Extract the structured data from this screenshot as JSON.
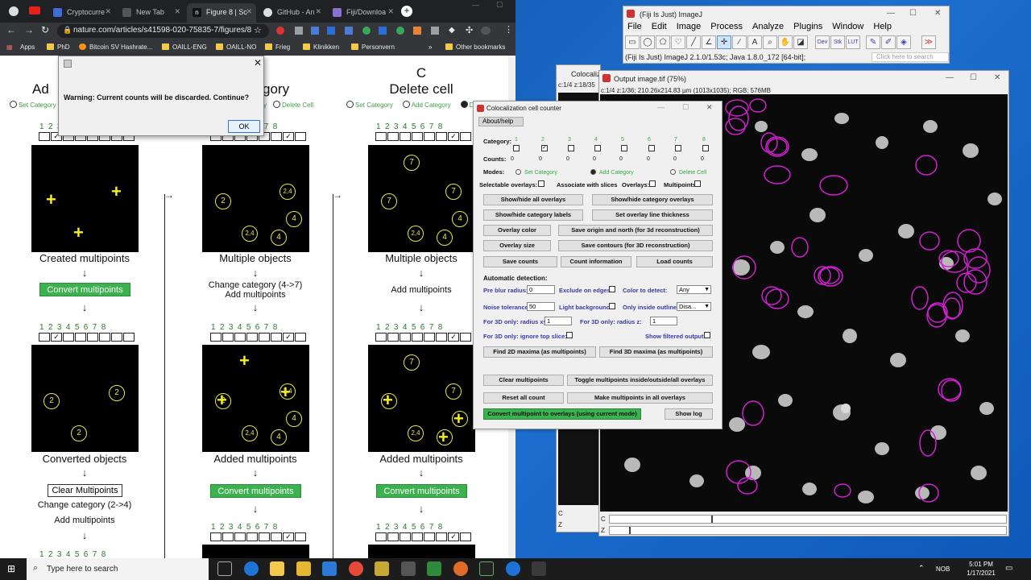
{
  "browser": {
    "tabs": [
      {
        "label": "Cryptocurre",
        "color": "#3b6fd6"
      },
      {
        "label": "New Tab",
        "color": "#555"
      },
      {
        "label": "Figure 8 | Sc",
        "color": "#e8eaed"
      },
      {
        "label": "GitHub - An",
        "color": "#ddd"
      },
      {
        "label": "Fiji/Downloa",
        "color": "#8b6fd1"
      }
    ],
    "url": "nature.com/articles/s41598-020-75835-7/figures/8",
    "bookmarks": [
      "Apps",
      "PhD",
      "Bitcoin SV Hashrate...",
      "OAILL-ENG",
      "OAILL-NO",
      "Frieg",
      "Klinikken",
      "Personvern"
    ],
    "other_bookmarks": "Other bookmarks"
  },
  "figure": {
    "col_a_title": "Ad",
    "col_b_title": "gory",
    "col_c_letter": "C",
    "col_c_title": "Delete cell",
    "radio_set": "Set Category",
    "radio_add": "Add Category",
    "radio_del": "Delete Cell",
    "radio_del_short": "Dele",
    "cat_numbers": "12345678",
    "a_lbl1": "Created multipoints",
    "a_btn1": "Convert multipoints",
    "a_lbl2": "Converted objects",
    "a_btn2": "Clear Multipoints",
    "a_txt1": "Change category (2->4)",
    "a_txt2": "Add multipoints",
    "b_lbl1": "Multiple objects",
    "b_txt1": "Change category (4->7)",
    "b_txt2": "Add multipoints",
    "b_lbl2": "Added multipoints",
    "b_btn": "Convert multipoints",
    "c_lbl1": "Multiple objects",
    "c_txt1": "Add multipoints",
    "c_lbl2": "Added multipoints",
    "c_btn": "Convert multipoints"
  },
  "dialog": {
    "message": "Warning: Current counts will be discarded. Continue?",
    "ok": "OK"
  },
  "imagej": {
    "title": "(Fiji Is Just) ImageJ",
    "menus": [
      "File",
      "Edit",
      "Image",
      "Process",
      "Analyze",
      "Plugins",
      "Window",
      "Help"
    ],
    "status": "(Fiji Is Just) ImageJ 2.1.0/1.53c; Java 1.8.0_172 [64-bit];",
    "search_placeholder": "Click here to search",
    "tools_labels": [
      "Dev",
      "Stk",
      "LUT"
    ]
  },
  "coloc_win": {
    "title": "Colocaliz",
    "info": "c:1/4 z:18/35"
  },
  "image_win": {
    "title": "Output image.tif (75%)",
    "info": "c:1/4 z:1/36; 210.26x214.83 µm (1013x1035); RGB; 576MB",
    "c_label": "C",
    "z_label": "Z"
  },
  "counter": {
    "title": "Colocalization cell counter",
    "about": "About/help",
    "category_label": "Category:",
    "counts_label": "Counts:",
    "modes_label": "Modes:",
    "categories": [
      "1",
      "2",
      "3",
      "4",
      "5",
      "6",
      "7",
      "8"
    ],
    "counts": [
      "0",
      "0",
      "0",
      "0",
      "0",
      "0",
      "0",
      "0"
    ],
    "mode_set": "Set Category",
    "mode_add": "Add Category",
    "mode_del": "Delete Cell",
    "selectable": "Selectable overlays:",
    "assoc": "Associate with slices",
    "overlays": "Overlays:",
    "multipoints": "Multipoints:",
    "btn_show_all": "Show/hide all overlays",
    "btn_show_cat": "Show/hide category overlays",
    "btn_cat_labels": "Show/hide category labels",
    "btn_line": "Set overlay line thickness",
    "btn_color": "Overlay color",
    "btn_save_origin": "Save origin and north (for 3d reconstruction)",
    "btn_size": "Overlay size",
    "btn_save_contours": "Save contours (for 3D reconstruction)",
    "btn_save_counts": "Save counts",
    "btn_count_info": "Count information",
    "btn_load": "Load counts",
    "auto_label": "Automatic detection:",
    "preblur_label": "Pre blur radius:",
    "preblur": "0",
    "exclude": "Exclude on edges",
    "color_detect": "Color to detect:",
    "color_val": "Any",
    "noise_label": "Noise tolerance:",
    "noise": "50",
    "light_bg": "Light background:",
    "only_inside": "Only inside outlines:",
    "only_val": "Disa...",
    "r_xy_label": "For 3D only: radius xy:",
    "r_xy": "1",
    "r_z_label": "For 3D only: radius z:",
    "r_z": "1",
    "ignore_top": "For 3D only: ignore top slice:",
    "show_filtered": "Show filtered output:",
    "btn_2d": "Find 2D maxima (as multipoints)",
    "btn_3d": "Find 3D maxima (as multipoints)",
    "btn_clear": "Clear multipoints",
    "btn_toggle": "Toggle multipoints inside/outside/all overlays",
    "btn_reset": "Reset all count",
    "btn_make": "Make multipoints in all overlays",
    "btn_convert": "Convert multipoint to overlays (using current mode)",
    "btn_log": "Show log"
  },
  "taskbar": {
    "search": "Type here to search",
    "lang": "NOB",
    "time": "5:01 PM",
    "date": "1/17/2021"
  },
  "colors": {
    "accent_green": "#3cb24f",
    "overlay_magenta": "#d020d0",
    "marker_yellow": "#f3ef21"
  }
}
